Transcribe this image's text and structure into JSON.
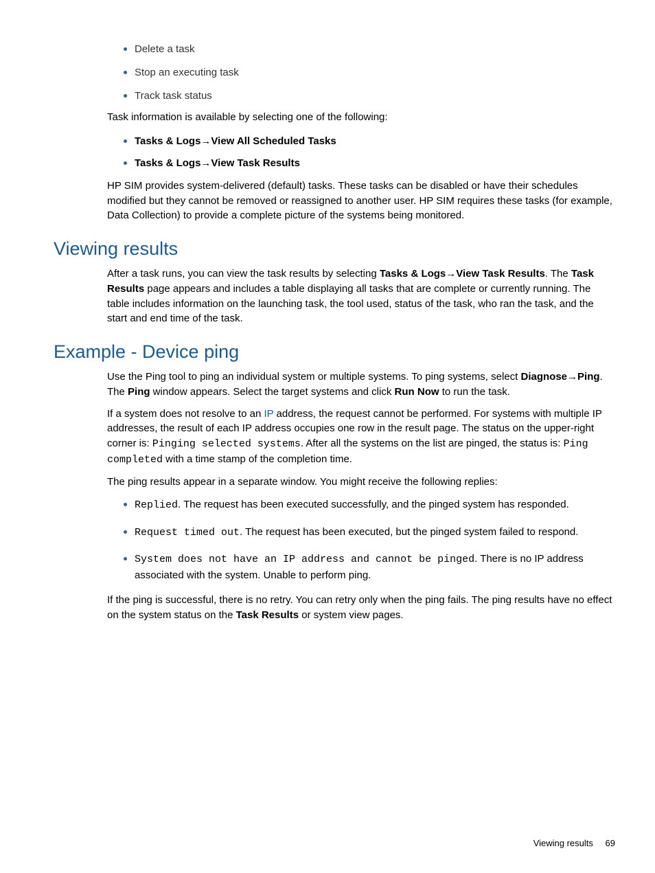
{
  "topBullets": [
    "Delete a task",
    "Stop an executing task",
    "Track task status"
  ],
  "taskInfoIntro": "Task information is available by selecting one of the following:",
  "boldBullets": {
    "b1_prefix": "Tasks & Logs",
    "b1_suffix": "View All Scheduled Tasks",
    "b2_prefix": "Tasks & Logs",
    "b2_suffix": "View Task Results"
  },
  "paraSystemDelivered": "HP SIM provides system-delivered (default) tasks. These tasks can be disabled or have their schedules modified but they cannot be removed or reassigned to another user. HP SIM requires these tasks (for example, Data Collection) to provide a complete picture of the systems being monitored.",
  "h2Viewing": "Viewing results",
  "viewing": {
    "pre": "After a task runs, you can view the task results by selecting ",
    "bold1_prefix": "Tasks & Logs",
    "bold1_suffix": "View Task Results",
    "mid1": ". The ",
    "bold2": "Task Results",
    "post": " page appears and includes a table displaying all tasks that are complete or currently running. The table includes information on the launching task, the tool used, status of the task, who ran the task, and the start and end time of the task."
  },
  "h2Example": "Example - Device ping",
  "example": {
    "p1_pre": "Use the Ping tool to ping an individual system or multiple systems. To ping systems, select ",
    "p1_b1_prefix": "Diagnose",
    "p1_b1_suffix": "Ping",
    "p1_mid1": ". The ",
    "p1_b2": "Ping",
    "p1_mid2": " window appears. Select the target systems and click ",
    "p1_b3": "Run Now",
    "p1_post": " to run the task.",
    "p2_pre": "If a system does not resolve to an ",
    "p2_link": "IP",
    "p2_mid1": " address, the request cannot be performed. For systems with multiple IP addresses, the result of each IP address occupies one row in the result page. The status on the upper-right corner is: ",
    "p2_mono1": "Pinging selected systems",
    "p2_mid2": ". After all the systems on the list are pinged, the status is: ",
    "p2_mono2": "Ping completed",
    "p2_post": " with a time stamp of the completion time.",
    "p3": "The ping results appear in a separate window. You might receive the following replies:"
  },
  "replies": {
    "r1_mono": "Replied",
    "r1_text": ". The request has been executed successfully, and the pinged system has responded.",
    "r2_mono": "Request timed out",
    "r2_text": ". The request has been executed, but the pinged system failed to respond.",
    "r3_mono": "System does not have an IP address and cannot be pinged",
    "r3_text": ". There is no IP address associated with the system. Unable to perform ping."
  },
  "finalPara": {
    "pre": "If the ping is successful, there is no retry. You can retry only when the ping fails. The ping results have no effect on the system status on the ",
    "bold": "Task Results",
    "post": " or system view pages."
  },
  "footer": {
    "section": "Viewing results",
    "page": "69"
  },
  "arrow": "→"
}
